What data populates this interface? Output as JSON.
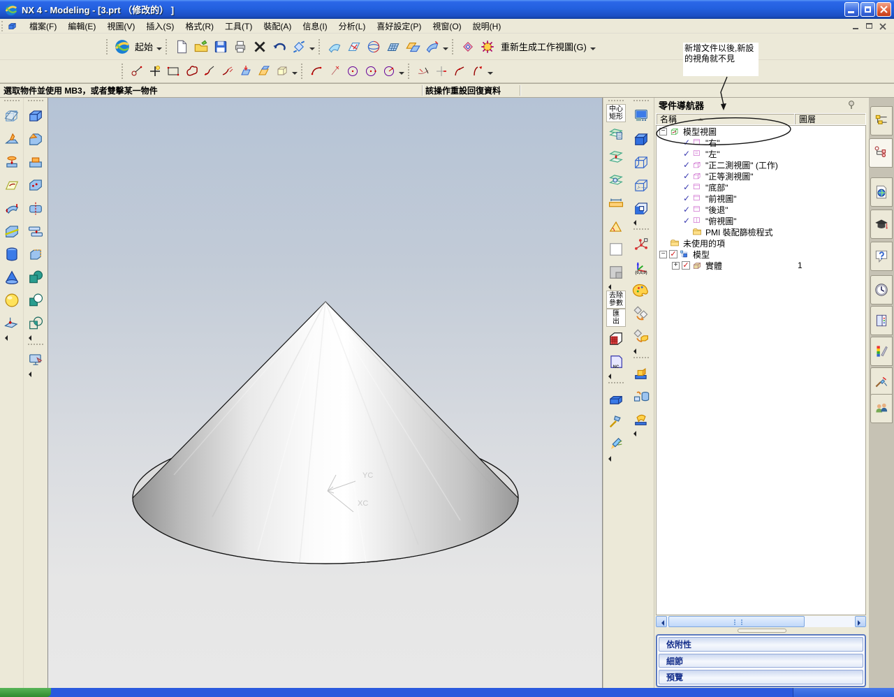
{
  "window": {
    "title": "NX 4 - Modeling - [3.prt （修改的） ]"
  },
  "menu": {
    "items": [
      "檔案(F)",
      "編輯(E)",
      "視圖(V)",
      "插入(S)",
      "格式(R)",
      "工具(T)",
      "裝配(A)",
      "信息(I)",
      "分析(L)",
      "喜好設定(P)",
      "視窗(O)",
      "說明(H)"
    ]
  },
  "toolbars": {
    "start_label": "起始",
    "regen_label": "重新生成工作視圖(G)",
    "standard_icons": [
      {
        "kind": "page",
        "name": "new-file-icon"
      },
      {
        "kind": "folder-open",
        "name": "open-file-icon"
      },
      {
        "kind": "floppy",
        "name": "save-icon"
      },
      {
        "kind": "printer",
        "name": "print-icon"
      },
      {
        "kind": "xmark",
        "name": "delete-icon"
      },
      {
        "kind": "undo",
        "name": "undo-icon"
      },
      {
        "kind": "orient",
        "name": "orient-view-icon"
      },
      {
        "kind": "caret",
        "name": "orient-view-dropdown"
      }
    ],
    "view_icons": [
      {
        "kind": "sheet-blue",
        "name": "shaded-sheet-icon"
      },
      {
        "kind": "sheet-mesh",
        "name": "analyze-sheet-icon"
      },
      {
        "kind": "rotate-sphere",
        "name": "rotate-view-icon"
      },
      {
        "kind": "quilt-grid",
        "name": "grid-sheet-icon"
      },
      {
        "kind": "sheet-pair",
        "name": "sheet-pair-icon"
      },
      {
        "kind": "swept-sheet",
        "name": "swept-sheet-icon"
      },
      {
        "kind": "caret",
        "name": "view-group-dropdown"
      }
    ],
    "regen_icons": [
      {
        "kind": "diamond-face",
        "name": "face-analysis-icon"
      },
      {
        "kind": "gear-tool",
        "name": "curve-analysis-icon"
      }
    ],
    "sketch1_icons": [
      {
        "kind": "profile",
        "name": "profile-icon"
      },
      {
        "kind": "point-plus",
        "name": "point-icon"
      },
      {
        "kind": "rect-tool",
        "name": "rectangle-icon"
      },
      {
        "kind": "spline-profile",
        "name": "studio-spline-icon"
      },
      {
        "kind": "fillet-a",
        "name": "chamfer-curve-icon"
      },
      {
        "kind": "fillet-b",
        "name": "fillet-curve-icon"
      },
      {
        "kind": "sheet-drop",
        "name": "project-curve-icon"
      },
      {
        "kind": "corner-surface",
        "name": "intersect-curve-icon"
      },
      {
        "kind": "wire-box",
        "name": "wire-box-icon"
      },
      {
        "kind": "caret",
        "name": "curve-group-dropdown"
      }
    ],
    "sketch2_icons": [
      {
        "kind": "arc-tool",
        "name": "arc-icon"
      },
      {
        "kind": "point-vert",
        "name": "point-on-curve-icon"
      },
      {
        "kind": "circle-a",
        "name": "circle-icon"
      },
      {
        "kind": "circle-b",
        "name": "circle-center-icon"
      },
      {
        "kind": "circle-c",
        "name": "circle-radius-icon"
      },
      {
        "kind": "caret",
        "name": "circle-group-dropdown"
      }
    ],
    "sketch3_icons": [
      {
        "kind": "trim-tool",
        "name": "quick-trim-icon"
      },
      {
        "kind": "extend-tool",
        "name": "quick-extend-icon"
      },
      {
        "kind": "fillet-tool",
        "name": "curve-fillet-icon"
      },
      {
        "kind": "flip-tool",
        "name": "curve-flip-icon"
      },
      {
        "kind": "caret",
        "name": "edit-curve-dropdown"
      }
    ]
  },
  "prompt": {
    "left": "選取物件並使用 MB3，或者雙擊某一物件",
    "center": "該操作重設回復資料"
  },
  "annotation_note": {
    "text": "新增文件以後,新設\n的視角就不見"
  },
  "viewport": {
    "axis_y": "YC",
    "axis_x": "XC"
  },
  "left_toolbar": {
    "col1": [
      {
        "kind": "grip-h",
        "name": "toolbar-grip"
      },
      {
        "kind": "datum-plane",
        "name": "datum-plane-icon"
      },
      {
        "kind": "rib",
        "name": "rib-icon"
      },
      {
        "kind": "extrude-boss",
        "name": "extrude-icon"
      },
      {
        "kind": "sketch-sheet",
        "name": "sketch-icon"
      },
      {
        "kind": "bend-sheet",
        "name": "bend-sheet-icon"
      },
      {
        "kind": "trim-body",
        "name": "trim-body-icon"
      },
      {
        "kind": "cylinder",
        "name": "cylinder-icon"
      },
      {
        "kind": "cone",
        "name": "cone-icon"
      },
      {
        "kind": "sphere",
        "name": "sphere-icon"
      },
      {
        "kind": "datum-csys",
        "name": "datum-csys-icon"
      },
      {
        "kind": "collapse",
        "name": "collapse-arrow"
      }
    ],
    "col2": [
      {
        "kind": "grip-h",
        "name": "toolbar-grip"
      },
      {
        "kind": "block",
        "name": "block-icon"
      },
      {
        "kind": "chamfer-block",
        "name": "chamfer-icon"
      },
      {
        "kind": "pad",
        "name": "pad-icon"
      },
      {
        "kind": "hollow",
        "name": "hollow-icon"
      },
      {
        "kind": "split-body",
        "name": "split-body-icon"
      },
      {
        "kind": "sew",
        "name": "sew-icon"
      },
      {
        "kind": "offset-body",
        "name": "offset-body-icon"
      },
      {
        "kind": "unite",
        "name": "unite-icon"
      },
      {
        "kind": "subtract",
        "name": "subtract-icon"
      },
      {
        "kind": "intersect",
        "name": "intersect-icon"
      },
      {
        "kind": "collapse",
        "name": "collapse-arrow"
      },
      {
        "kind": "grip-h",
        "name": "toolbar-grip"
      },
      {
        "kind": "visualize",
        "name": "visualize-shape-icon"
      },
      {
        "kind": "collapse",
        "name": "collapse-arrow"
      }
    ]
  },
  "right_toolbar": {
    "colA": [
      {
        "kind": "grip-h",
        "name": "toolbar-grip"
      },
      {
        "kind": "text-btn",
        "name": "center-rectangle-button",
        "lines": [
          "中心",
          "矩形"
        ]
      },
      {
        "kind": "layer-settings",
        "name": "layer-settings-icon"
      },
      {
        "kind": "layer-copy",
        "name": "layer-copy-icon"
      },
      {
        "kind": "layer-visible",
        "name": "layer-visible-icon"
      },
      {
        "kind": "measure-distance",
        "name": "measure-distance-icon"
      },
      {
        "kind": "measure-angle",
        "name": "measure-angle-icon"
      },
      {
        "kind": "measure-face",
        "name": "measure-face-icon"
      },
      {
        "kind": "bounded-plane",
        "name": "bounded-plane-icon"
      },
      {
        "kind": "collapse",
        "name": "collapse-arrow"
      },
      {
        "kind": "text-btn",
        "name": "remove-parameters-button",
        "lines": [
          "去除",
          "參數"
        ]
      },
      {
        "kind": "text-btn",
        "name": "export-button",
        "lines": [
          "匯",
          "出"
        ]
      },
      {
        "kind": "mesh-cube-red",
        "name": "facet-body-icon"
      },
      {
        "kind": "nc-book",
        "name": "nc-output-icon",
        "sub": "NC"
      },
      {
        "kind": "collapse",
        "name": "collapse-arrow"
      },
      {
        "kind": "grip-h",
        "name": "toolbar-grip"
      },
      {
        "kind": "blue-block",
        "name": "solid-tool-icon"
      },
      {
        "kind": "hammer",
        "name": "repair-tool-icon"
      },
      {
        "kind": "pencil-wing",
        "name": "annotate-tool-icon"
      },
      {
        "kind": "collapse",
        "name": "collapse-arrow"
      }
    ],
    "colB": [
      {
        "kind": "grip-h",
        "name": "toolbar-grip"
      },
      {
        "kind": "snapshot",
        "name": "snapshot-icon"
      },
      {
        "kind": "cube-shaded",
        "name": "shaded-display-icon"
      },
      {
        "kind": "cube-wire",
        "name": "wireframe-display-icon"
      },
      {
        "kind": "cube-hidden",
        "name": "hidden-wireframe-icon"
      },
      {
        "kind": "cube-section",
        "name": "section-display-icon"
      },
      {
        "kind": "collapse",
        "name": "collapse-arrow"
      },
      {
        "kind": "grip-h",
        "name": "toolbar-grip"
      },
      {
        "kind": "wcs-constellation",
        "name": "wcs-dynamics-icon"
      },
      {
        "kind": "csys-triad",
        "name": "csys-orient-icon",
        "sub": "(0,0,0)"
      },
      {
        "kind": "palette",
        "name": "object-display-icon"
      },
      {
        "kind": "diamonds-arrow",
        "name": "move-object-icon"
      },
      {
        "kind": "diamond-cube",
        "name": "copy-object-icon"
      },
      {
        "kind": "collapse",
        "name": "collapse-arrow"
      },
      {
        "kind": "grip-h",
        "name": "toolbar-grip"
      },
      {
        "kind": "boss-a",
        "name": "boss-icon"
      },
      {
        "kind": "boss-b",
        "name": "pocket-icon"
      },
      {
        "kind": "boss-c",
        "name": "pad-feature-icon"
      },
      {
        "kind": "collapse",
        "name": "collapse-arrow"
      }
    ]
  },
  "part_navigator": {
    "title": "零件導航器",
    "column_name": "名稱",
    "column_layer": "圖層",
    "tree": [
      {
        "level": 0,
        "expand": "minus",
        "icon": "model-views",
        "label": "模型視圖"
      },
      {
        "level": 1,
        "check": "blue",
        "icon": "view-flat",
        "label": "\"右\""
      },
      {
        "level": 1,
        "check": "blue",
        "icon": "view-flat2",
        "label": "\"左\""
      },
      {
        "level": 1,
        "check": "blue",
        "icon": "view-cube",
        "label": "\"正二測視圖\" (工作)"
      },
      {
        "level": 1,
        "check": "blue",
        "icon": "view-cube",
        "label": "\"正等測視圖\""
      },
      {
        "level": 1,
        "check": "blue",
        "icon": "view-flat",
        "label": "\"底部\""
      },
      {
        "level": 1,
        "check": "blue",
        "icon": "view-flat",
        "label": "\"前視圖\""
      },
      {
        "level": 1,
        "check": "blue",
        "icon": "view-flat",
        "label": "\"後退\""
      },
      {
        "level": 1,
        "check": "blue",
        "icon": "view-flat3",
        "label": "\"俯視圖\""
      },
      {
        "level": 1,
        "icon": "folder-std",
        "label": "PMI 裝配篩檢程式"
      },
      {
        "level": 0,
        "icon": "folder-std",
        "label": "未使用的項"
      },
      {
        "level": 0,
        "expand": "minus",
        "check": "red",
        "icon": "model-node",
        "label": "模型"
      },
      {
        "level": 1,
        "expand": "plus",
        "check": "red",
        "icon": "solid-body",
        "label": "實體",
        "layer": "1"
      }
    ],
    "panels": [
      "依附性",
      "細節",
      "預覽"
    ]
  },
  "resource_bar": {
    "tabs": [
      {
        "kind": "assembly-nav",
        "name": "tab-assembly-navigator"
      },
      {
        "kind": "part-nav",
        "name": "tab-part-navigator",
        "active": true
      },
      {
        "kind": "web-browser",
        "name": "tab-web-browser"
      },
      {
        "kind": "training",
        "name": "tab-training"
      },
      {
        "kind": "help",
        "name": "tab-help"
      },
      {
        "kind": "history",
        "name": "tab-history"
      },
      {
        "kind": "palettes-book",
        "name": "tab-palettes"
      },
      {
        "kind": "visual-rainbow",
        "name": "tab-visualization"
      },
      {
        "kind": "render-tools",
        "name": "tab-render-tools"
      },
      {
        "kind": "collaboration",
        "name": "tab-collaboration"
      }
    ]
  },
  "colors": {
    "titlebar_blue": "#2360de",
    "toolbar_beige": "#ece9d8",
    "taskbar_blue": "#2a5ade",
    "panel_label_blue": "#16308c",
    "viewport_top": "#b5c3d6",
    "viewport_bottom": "#e8e8e8"
  }
}
